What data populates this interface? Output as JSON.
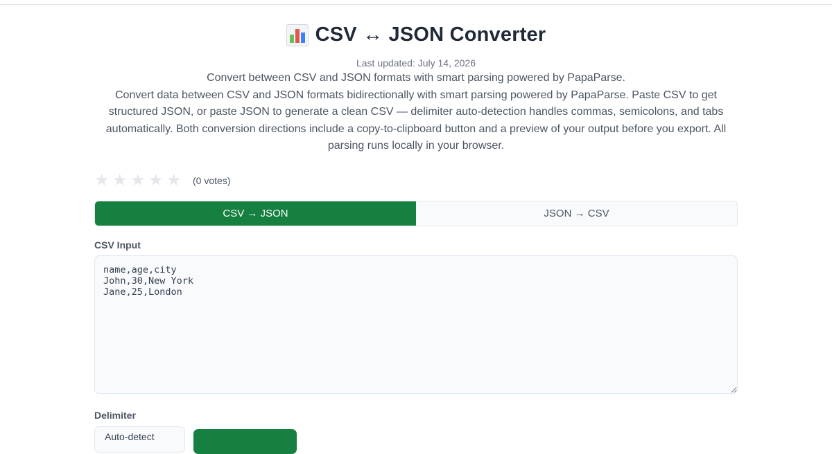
{
  "header": {
    "title": "CSV ↔ JSON Converter",
    "icon": "bar-chart-icon",
    "updated": "Last updated: July 14, 2026",
    "tagline": "Convert between CSV and JSON formats with smart parsing powered by PapaParse.",
    "description": "Convert data between CSV and JSON formats bidirectionally with smart parsing powered by PapaParse. Paste CSV to get structured JSON, or paste JSON to generate a clean CSV — delimiter auto-detection handles commas, semicolons, and tabs automatically. Both conversion directions include a copy-to-clipboard button and a preview of your output before you export. All parsing runs locally in your browser."
  },
  "rating": {
    "stars_filled": 0,
    "stars_total": 5,
    "votes": "(0 votes)"
  },
  "tabs": [
    {
      "label": "CSV → JSON",
      "active": true
    },
    {
      "label": "JSON → CSV",
      "active": false
    }
  ],
  "input": {
    "label": "CSV Input",
    "value": "name,age,city\nJohn,30,New York\nJane,25,London"
  },
  "delimiter": {
    "label": "Delimiter",
    "selected": "Auto-detect"
  },
  "colors": {
    "accent": "#168040",
    "text": "#1f2937",
    "muted": "#4b5563"
  }
}
